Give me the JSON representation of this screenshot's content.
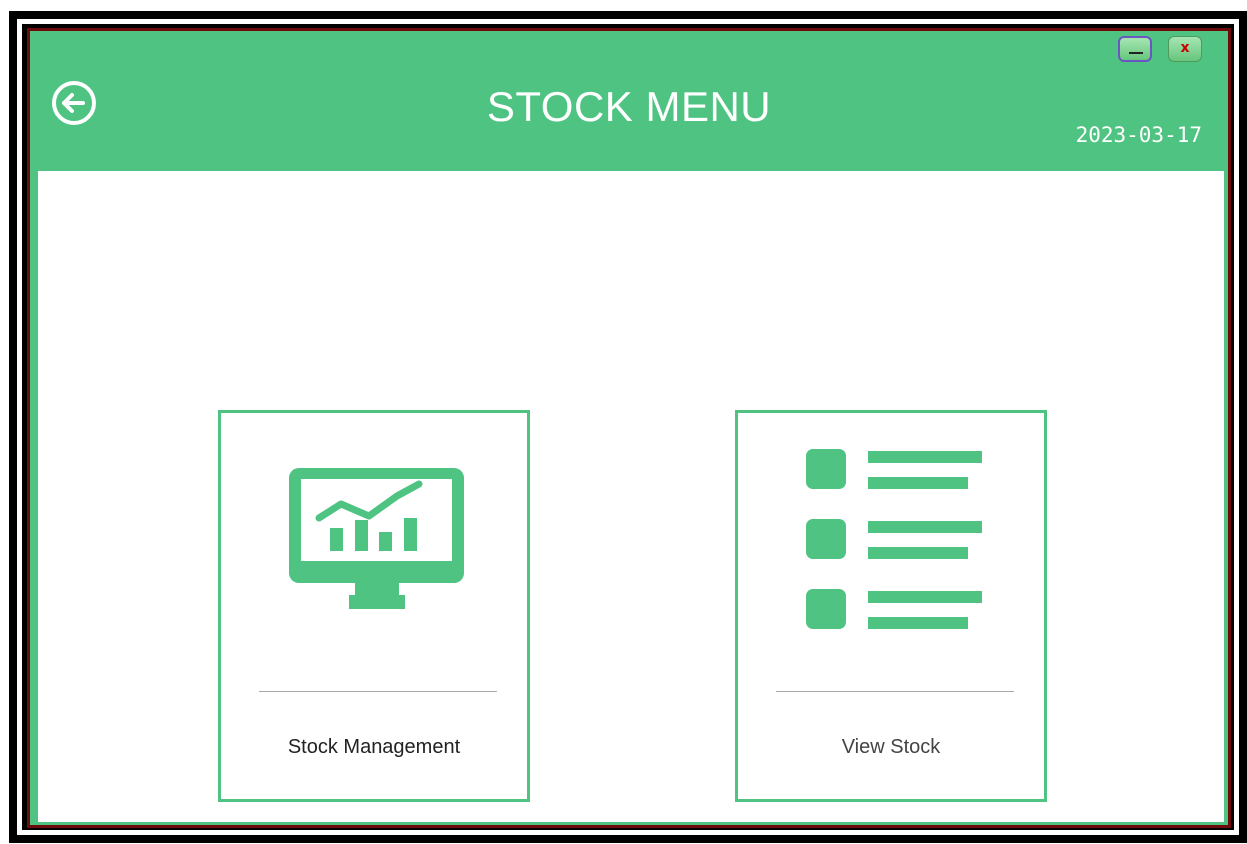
{
  "header": {
    "title": "STOCK MENU",
    "date": "2023-03-17"
  },
  "window_controls": {
    "minimize_symbol": "—",
    "close_symbol": "x"
  },
  "menu": {
    "cards": [
      {
        "label": "Stock Management",
        "icon": "monitor-chart-icon"
      },
      {
        "label": "View Stock",
        "icon": "list-icon"
      }
    ]
  },
  "colors": {
    "accent": "#4fc482",
    "frame_red": "#6e0a0a",
    "close_x": "#cc0000"
  }
}
